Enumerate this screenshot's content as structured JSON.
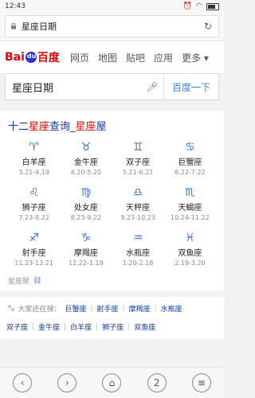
{
  "status": {
    "time": "12:43"
  },
  "url": {
    "text": "星座日期"
  },
  "baidu": {
    "logo_bai": "Bai",
    "logo_du": "du",
    "logo_cn": "百度",
    "nav": [
      "网页",
      "地图",
      "贴吧",
      "应用",
      "更多"
    ],
    "search_value": "星座日期",
    "search_button": "百度一下"
  },
  "card": {
    "title_part1": "十二",
    "title_hl": "星座",
    "title_part2": "查询_",
    "title_part3": "星座",
    "title_part4": "屋",
    "zodiacs": [
      {
        "icon": "♈",
        "name": "白羊座",
        "date": "3.21-4.19"
      },
      {
        "icon": "♉",
        "name": "金牛座",
        "date": "4.20-5.20"
      },
      {
        "icon": "♊",
        "name": "双子座",
        "date": "5.21-6.21"
      },
      {
        "icon": "♋",
        "name": "巨蟹座",
        "date": "6.22-7.22"
      },
      {
        "icon": "♌",
        "name": "狮子座",
        "date": "7.23-8.22"
      },
      {
        "icon": "♍",
        "name": "处女座",
        "date": "8.23-9.22"
      },
      {
        "icon": "♎",
        "name": "天秤座",
        "date": "9.23-10.23"
      },
      {
        "icon": "♏",
        "name": "天蝎座",
        "date": "10.24-11.22"
      },
      {
        "icon": "♐",
        "name": "射手座",
        "date": "11.23-12.21"
      },
      {
        "icon": "♑",
        "name": "摩羯座",
        "date": "12.22-1.19"
      },
      {
        "icon": "♒",
        "name": "水瓶座",
        "date": "1.20-2.18"
      },
      {
        "icon": "♓",
        "name": "双鱼座",
        "date": "2.19-3.20"
      }
    ],
    "footer": "星座屋"
  },
  "related": {
    "label": "大家还在搜：",
    "row1": [
      "巨蟹座",
      "射手座",
      "摩羯座",
      "水瓶座"
    ],
    "row2": [
      "双子座",
      "金牛座",
      "白羊座",
      "狮子座",
      "双鱼座"
    ]
  },
  "bottom": {
    "tabs_count": "2"
  }
}
